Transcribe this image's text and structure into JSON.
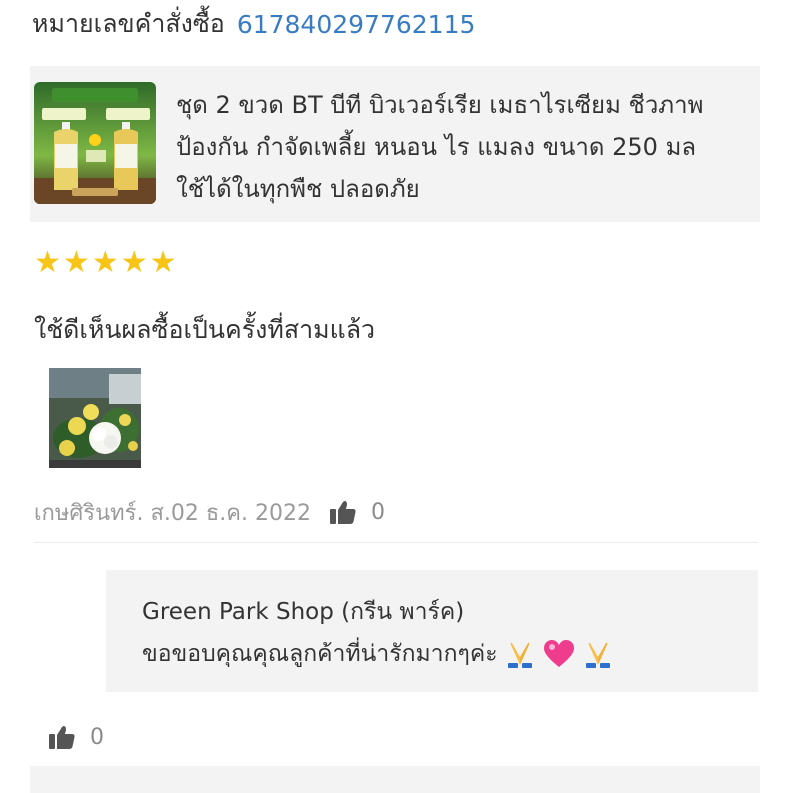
{
  "order": {
    "label": "หมายเลขคำสั่งซื้อ",
    "number": "617840297762115"
  },
  "product": {
    "title": "ชุด 2 ขวด BT บีที บิวเวอร์เรีย เมธาไรเซียม ชีวภาพ ป้องกัน กำจัดเพลี้ย หนอน ไร แมลง ขนาด 250 มล ใช้ได้ในทุกพืช ปลอดภัย",
    "thumbnail_icon": "product-bottles-image"
  },
  "review": {
    "rating": 5,
    "rating_max": 5,
    "text": "ใช้ดีเห็นผลซื้อเป็นครั้งที่สามแล้ว",
    "photo_icon": "flower-photo",
    "author_date": "เกษศิรินทร์. ส.02 ธ.ค. 2022",
    "like_count": "0"
  },
  "reply": {
    "shop_name": "Green Park Shop (กรีน พาร์ค)",
    "text": "ขอขอบคุณคุณลูกค้าที่น่ารักมากๆค่ะ",
    "emojis": [
      "folded-hands-icon",
      "pink-heart-icon",
      "folded-hands-icon"
    ],
    "like_count": "0"
  },
  "colors": {
    "accent_link": "#3a7cc1",
    "star": "#f7c518",
    "card_bg": "#f3f3f3",
    "muted_text": "#9a9a9a"
  }
}
